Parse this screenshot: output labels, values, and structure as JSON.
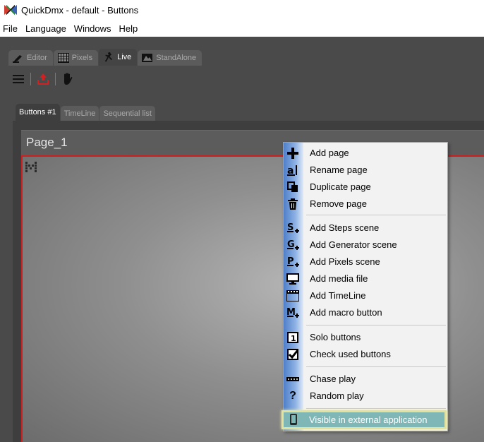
{
  "window": {
    "title": "QuickDmx - default - Buttons",
    "app_icon": "quickdmx-app-icon"
  },
  "menubar": [
    "File",
    "Language",
    "Windows",
    "Help"
  ],
  "top_tabs": [
    {
      "label": "Editor",
      "icon": "editor-icon",
      "active": false
    },
    {
      "label": "Pixels",
      "icon": "pixels-grid-icon",
      "active": false
    },
    {
      "label": "Live",
      "icon": "dancer-icon",
      "active": true
    },
    {
      "label": "StandAlone",
      "icon": "standalone-icon",
      "active": false
    }
  ],
  "toolbar": [
    "hamburger-menu-icon",
    "upload-red-icon",
    "hand-icon"
  ],
  "sub_tabs": [
    {
      "label": "Buttons #1",
      "active": true
    },
    {
      "label": "TimeLine",
      "active": false
    },
    {
      "label": "Sequential list",
      "active": false
    }
  ],
  "page": {
    "title": "Page_1"
  },
  "context_menu": {
    "items": [
      {
        "label": "Add page",
        "icon": "plus-icon"
      },
      {
        "label": "Rename page",
        "icon": "rename-icon"
      },
      {
        "label": "Duplicate page",
        "icon": "duplicate-icon"
      },
      {
        "label": "Remove page",
        "icon": "trash-icon"
      },
      {
        "label": "Add Steps scene",
        "icon": "steps-scene-icon"
      },
      {
        "label": "Add Generator scene",
        "icon": "generator-scene-icon"
      },
      {
        "label": "Add Pixels scene",
        "icon": "pixels-scene-icon"
      },
      {
        "label": "Add media file",
        "icon": "monitor-icon"
      },
      {
        "label": "Add TimeLine",
        "icon": "timeline-icon"
      },
      {
        "label": "Add macro button",
        "icon": "macro-icon"
      },
      {
        "label": "Solo buttons",
        "icon": "solo-icon"
      },
      {
        "label": "Check used buttons",
        "icon": "checkbox-icon"
      },
      {
        "label": "Chase play",
        "icon": "chase-icon"
      },
      {
        "label": "Random play",
        "icon": "question-icon"
      },
      {
        "label": "Visible in external application",
        "icon": "phone-icon",
        "highlighted": true
      }
    ]
  },
  "colors": {
    "accent_border": "#cc1f1f",
    "menu_gradient": "#4e7fc9",
    "highlight": "#7fb6b6"
  }
}
